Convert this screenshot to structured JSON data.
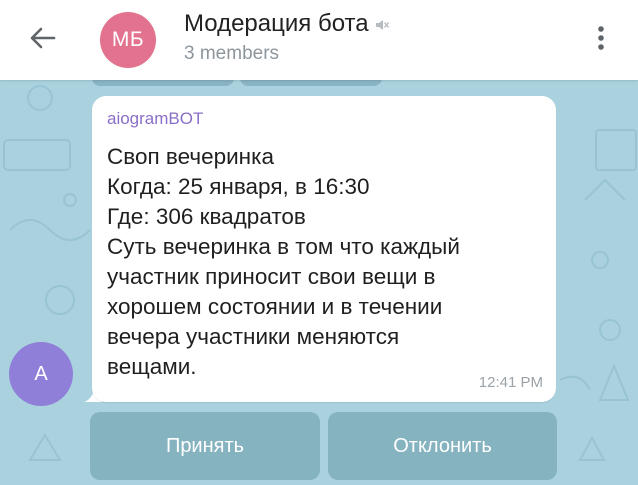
{
  "header": {
    "avatar_initials": "МБ",
    "title": "Модерация бота",
    "subtitle": "3 members",
    "avatar_color": "#e3728f"
  },
  "message": {
    "sender": "aiogramBOT",
    "sender_avatar_initial": "A",
    "sender_avatar_color": "#8f7fd9",
    "lines": [
      "Своп вечеринка",
      "Когда: 25 января, в 16:30",
      "Где: 306 квадратов",
      "Суть вечеринка в том что каждый",
      "участник приносит свои вещи в",
      "хорошем состоянии и в течении",
      "вечера участники меняются",
      "вещами."
    ],
    "time": "12:41 PM"
  },
  "inline_keyboard": {
    "accept_label": "Принять",
    "decline_label": "Отклонить"
  },
  "colors": {
    "chat_background": "#a9d2de",
    "bubble": "#ffffff",
    "sender_name": "#8a6fc7"
  }
}
